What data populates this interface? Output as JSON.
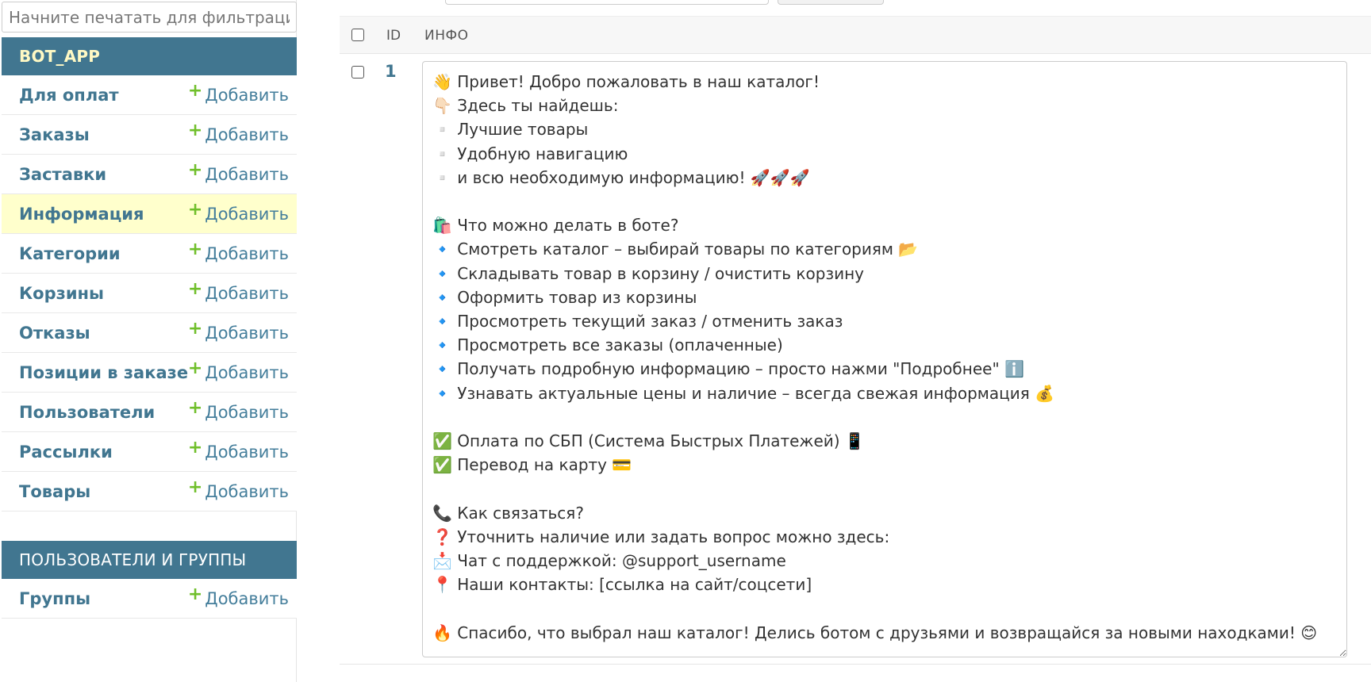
{
  "sidebar": {
    "filter_placeholder": "Начните печатать для фильтраци",
    "add_label": "Добавить",
    "modules": [
      {
        "caption": "BOT_APP",
        "models": [
          {
            "name": "Для оплат",
            "current": false
          },
          {
            "name": "Заказы",
            "current": false
          },
          {
            "name": "Заставки",
            "current": false
          },
          {
            "name": "Информация",
            "current": true
          },
          {
            "name": "Категории",
            "current": false
          },
          {
            "name": "Корзины",
            "current": false
          },
          {
            "name": "Отказы",
            "current": false
          },
          {
            "name": "Позиции в заказе",
            "current": false
          },
          {
            "name": "Пользователи",
            "current": false
          },
          {
            "name": "Рассылки",
            "current": false
          },
          {
            "name": "Товары",
            "current": false
          }
        ]
      },
      {
        "caption": "ПОЛЬЗОВАТЕЛИ И ГРУППЫ",
        "models": [
          {
            "name": "Группы",
            "current": false
          }
        ]
      }
    ]
  },
  "table": {
    "columns": {
      "id": "ID",
      "info": "ИНФО"
    },
    "rows": [
      {
        "id": "1",
        "info": "👋 Привет! Добро пожаловать в наш каталог!\n👇🏻 Здесь ты найдешь:\n▫️ Лучшие товары\n▫️ Удобную навигацию\n▫️ и всю необходимую информацию! 🚀🚀🚀\n\n🛍️ Что можно делать в боте?\n🔹 Смотреть каталог – выбирай товары по категориям 📂\n🔹 Складывать товар в корзину / очистить корзину\n🔹 Оформить товар из корзины\n🔹 Просмотреть текущий заказ / отменить заказ\n🔹 Просмотреть все заказы (оплаченные)\n🔹 Получать подробную информацию – просто нажми \"Подробнее\" ℹ️\n🔹 Узнавать актуальные цены и наличие – всегда свежая информация 💰\n\n✅ Оплата по СБП (Система Быстрых Платежей) 📱\n✅ Перевод на карту 💳\n\n📞 Как связаться?\n❓ Уточнить наличие или задать вопрос можно здесь:\n📩 Чат с поддержкой: @support_username\n📍 Наши контакты: [ссылка на сайт/соцсети]\n\n🔥 Спасибо, что выбрал наш каталог! Делись ботом с друзьями и возвращайся за новыми находками! 😊"
      }
    ]
  }
}
